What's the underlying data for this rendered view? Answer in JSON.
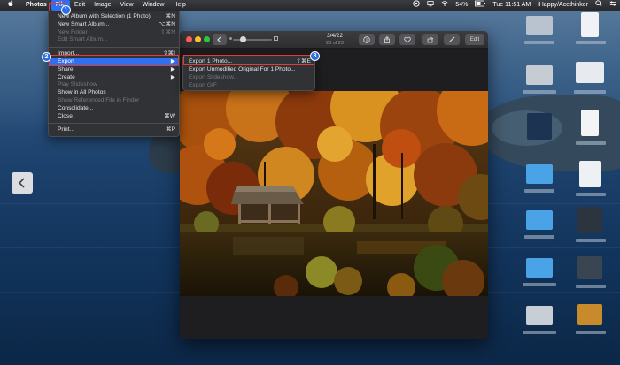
{
  "menubar": {
    "apple": "",
    "app_name": "Photos",
    "menus": [
      "File",
      "Edit",
      "Image",
      "View",
      "Window",
      "Help"
    ],
    "status": {
      "battery": "54%",
      "clock": "Tue 11:51 AM",
      "user": "iHappy/Acethinker"
    }
  },
  "file_menu": {
    "items": [
      {
        "label": "New Album with Selection (1 Photo)",
        "shortcut": "⌘N",
        "enabled": true
      },
      {
        "label": "New Smart Album...",
        "shortcut": "⌥⌘N",
        "enabled": true
      },
      {
        "label": "New Folder",
        "shortcut": "⇧⌘N",
        "enabled": false
      },
      {
        "label": "Edit Smart Album...",
        "shortcut": "",
        "enabled": false
      },
      {
        "label": "Import...",
        "shortcut": "⇧⌘I",
        "enabled": true
      },
      {
        "label": "Export",
        "shortcut": "▶",
        "enabled": true,
        "highlighted": true
      },
      {
        "label": "Share",
        "shortcut": "▶",
        "enabled": true
      },
      {
        "label": "Create",
        "shortcut": "▶",
        "enabled": true
      },
      {
        "label": "Play Slideshow",
        "shortcut": "",
        "enabled": false
      },
      {
        "label": "Show in All Photos",
        "shortcut": "",
        "enabled": true
      },
      {
        "label": "Show Referenced File in Finder",
        "shortcut": "",
        "enabled": false
      },
      {
        "label": "Consolidate...",
        "shortcut": "",
        "enabled": true
      },
      {
        "label": "Close",
        "shortcut": "⌘W",
        "enabled": true
      },
      {
        "label": "Print...",
        "shortcut": "⌘P",
        "enabled": true
      }
    ]
  },
  "export_submenu": {
    "items": [
      {
        "label": "Export 1 Photo...",
        "shortcut": "⇧⌘E",
        "enabled": true
      },
      {
        "label": "Export Unmodified Original For 1 Photo...",
        "shortcut": "",
        "enabled": true
      },
      {
        "label": "Export Slideshow...",
        "shortcut": "",
        "enabled": false
      },
      {
        "label": "Export GIF",
        "shortcut": "",
        "enabled": false
      }
    ]
  },
  "steps": [
    "1",
    "2",
    "3"
  ],
  "photos_window": {
    "date": "3/4/22",
    "count": "23 of 23",
    "edit_label": "Edit"
  },
  "colors": {
    "menu_highlight": "#2f6ff0",
    "annotation_red": "#e33a3a",
    "badge_blue": "#2a6de6"
  }
}
